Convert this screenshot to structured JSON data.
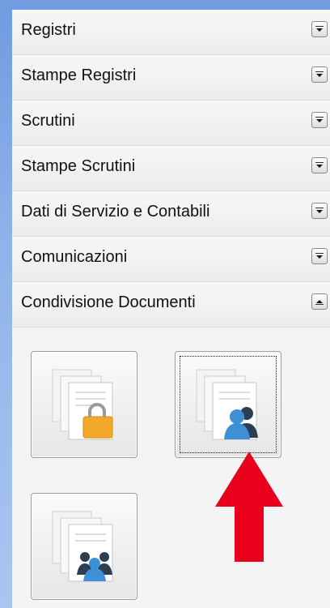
{
  "menu": {
    "sections": [
      {
        "label": "Registri",
        "expanded": false
      },
      {
        "label": "Stampe Registri",
        "expanded": false
      },
      {
        "label": "Scrutini",
        "expanded": false
      },
      {
        "label": "Stampe Scrutini",
        "expanded": false
      },
      {
        "label": "Dati di Servizio e Contabili",
        "expanded": false
      },
      {
        "label": "Comunicazioni",
        "expanded": false
      },
      {
        "label": "Condivisione Documenti",
        "expanded": true
      }
    ]
  },
  "documents": {
    "buttons": [
      {
        "icon": "document-lock-icon",
        "state": "normal"
      },
      {
        "icon": "document-shared-user-icon",
        "state": "focused"
      },
      {
        "icon": "document-group-icon",
        "state": "normal"
      }
    ]
  },
  "annotation": {
    "arrow_color": "#e8001c",
    "arrow_direction": "up"
  }
}
